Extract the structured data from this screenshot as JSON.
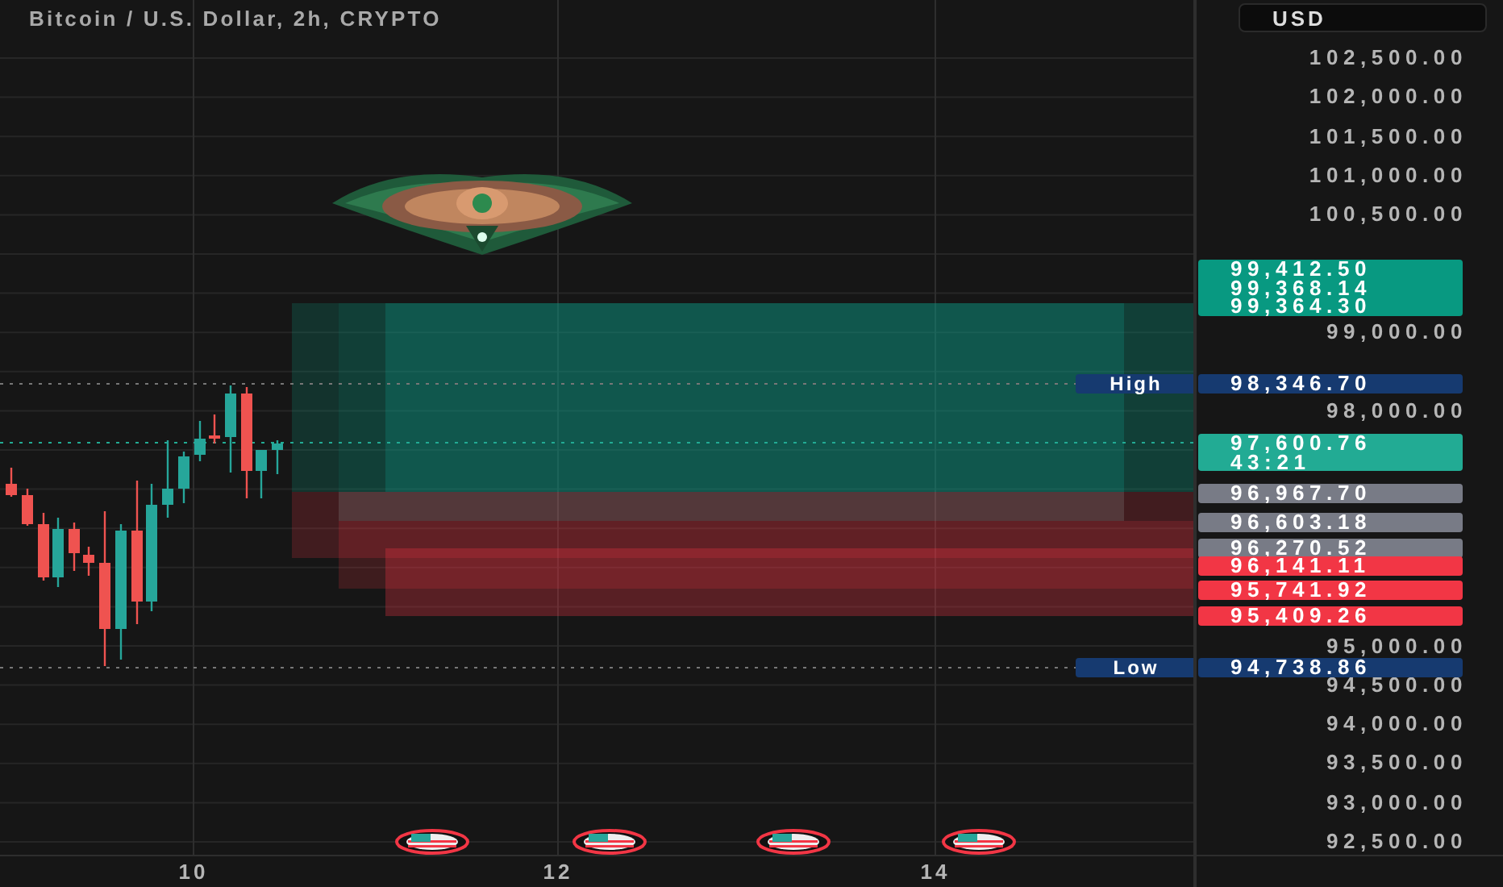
{
  "chart": {
    "title": "Bitcoin / U.S. Dollar, 2h, CRYPTO"
  },
  "price_axis": {
    "currency": "USD",
    "ticks": [
      "102,500.00",
      "102,000.00",
      "101,500.00",
      "101,000.00",
      "100,500.00",
      "99,000.00",
      "98,000.00",
      "95,000.00",
      "94,500.00",
      "94,000.00",
      "93,500.00",
      "93,000.00",
      "92,500.00"
    ],
    "labels": [
      {
        "lines": [
          "99,412.50",
          "99,368.14",
          "99,364.30"
        ],
        "color": "#089981"
      },
      {
        "lines": [
          "98,346.70"
        ],
        "tag": "High",
        "color": "#163a70"
      },
      {
        "lines": [
          "97,600.76",
          "43:21"
        ],
        "color": "#22ab94"
      },
      {
        "lines": [
          "96,967.70"
        ],
        "color": "#787b86"
      },
      {
        "lines": [
          "96,603.18"
        ],
        "color": "#787b86"
      },
      {
        "lines": [
          "96,270.52"
        ],
        "color": "#787b86"
      },
      {
        "lines": [
          "96,141.11"
        ],
        "color": "#f23645"
      },
      {
        "lines": [
          "95,741.92"
        ],
        "color": "#f23645"
      },
      {
        "lines": [
          "95,409.26"
        ],
        "color": "#f23645"
      },
      {
        "lines": [
          "94,738.86"
        ],
        "tag": "Low",
        "color": "#163a70"
      }
    ]
  },
  "time_axis": {
    "labels": [
      "10",
      "12",
      "14"
    ]
  }
}
